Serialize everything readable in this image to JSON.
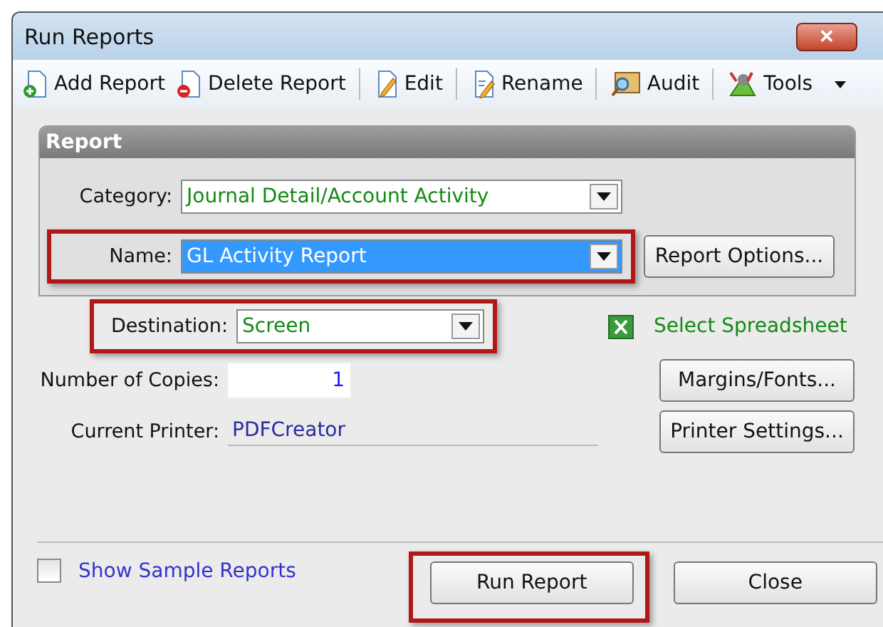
{
  "window": {
    "title": "Run Reports",
    "close_label": "✕"
  },
  "toolbar": [
    {
      "label": "Add Report",
      "kind": "add"
    },
    {
      "label": "Delete Report",
      "kind": "delete"
    },
    {
      "label": "Edit",
      "kind": "edit"
    },
    {
      "label": "Rename",
      "kind": "rename"
    },
    {
      "label": "Audit",
      "kind": "audit"
    },
    {
      "label": "Tools",
      "kind": "tools"
    }
  ],
  "report": {
    "title": "Report",
    "category": {
      "label": "Category:",
      "value": "Journal Detail/Account Activity",
      "highlighted": false,
      "selected": false
    },
    "name": {
      "label": "Name:",
      "value": "GL Activity Report",
      "highlighted": true,
      "selected": true
    },
    "options_button": "Report Options..."
  },
  "destination": {
    "label": "Destination:",
    "value": "Screen",
    "highlighted": true
  },
  "spreadsheet_link": "Select Spreadsheet",
  "copies": {
    "label": "Number of Copies:",
    "value": "1"
  },
  "printer": {
    "label": "Current Printer:",
    "value": "PDFCreator"
  },
  "side_buttons": [
    "Margins/Fonts...",
    "Printer Settings..."
  ],
  "show_sample": {
    "label": "Show Sample Reports",
    "checked": false
  },
  "footer_buttons": [
    {
      "label": "Run Report",
      "highlighted": true
    },
    {
      "label": "Close",
      "highlighted": false
    }
  ]
}
